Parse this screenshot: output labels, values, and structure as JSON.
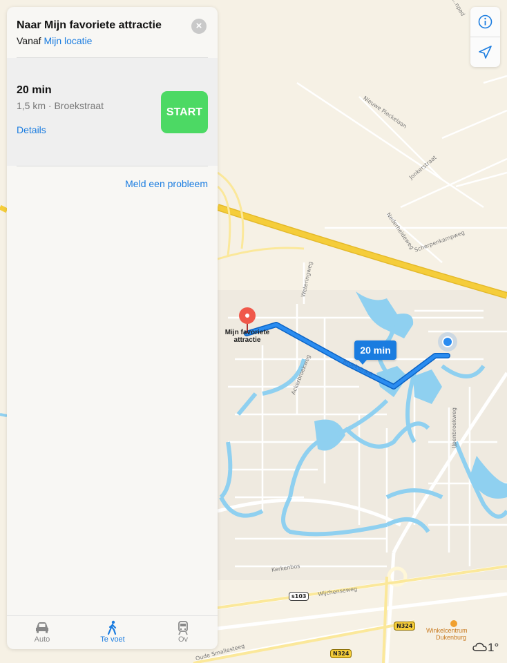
{
  "panel": {
    "title": "Naar Mijn favoriete attractie",
    "from_prefix": "Vanaf",
    "from_location": "Mijn locatie",
    "close_glyph": "×",
    "route": {
      "duration": "20 min",
      "description": "1,5 km · Broekstraat",
      "details_link": "Details",
      "start_button": "START"
    },
    "report_link": "Meld een probleem",
    "tabs": [
      {
        "label": "Auto",
        "icon": "car-icon"
      },
      {
        "label": "Te voet",
        "icon": "walk-icon",
        "active": true
      },
      {
        "label": "Ov",
        "icon": "train-icon"
      }
    ]
  },
  "map": {
    "route_time_label": "20 min",
    "destination_label": "Mijn favoriete attractie",
    "street_labels": {
      "nieuwe_pieckelaan": "Nieuwe Pieckelaan",
      "jonkerstraat": "Jonkerstraat",
      "nederheideweg": "Nederheideweg",
      "scherpenkampweg": "Scherpenkampweg",
      "weteringweg": "Weteringweg",
      "ackerbroekweg": "Ackerbroekweg",
      "broekstraat": "Broekstraat",
      "ijpenbroekweg": "IJpenbroekweg",
      "kerkenbos": "Kerkenbos",
      "wijchenseweg": "Wijchenseweg",
      "oude_smallesteeg": "Oude Smallesteeg",
      "top_right": "...npad"
    },
    "road_shields": {
      "s103": "s103",
      "n324_a": "N324",
      "n324_b": "N324"
    },
    "poi": {
      "name_line1": "Winkelcentrum",
      "name_line2": "Dukenburg"
    }
  },
  "controls": {
    "info_icon": "info-icon",
    "location_icon": "location-arrow-icon"
  },
  "weather": {
    "temperature": "1°",
    "icon": "cloud-icon"
  },
  "colors": {
    "accent": "#1a7ce0",
    "start_green": "#4cd964",
    "route_blue": "#1a7ce0",
    "water": "#8fd0f0",
    "highway": "#f5cd3a",
    "map_bg": "#f6f1e5",
    "destination_pin": "#f0584a"
  }
}
